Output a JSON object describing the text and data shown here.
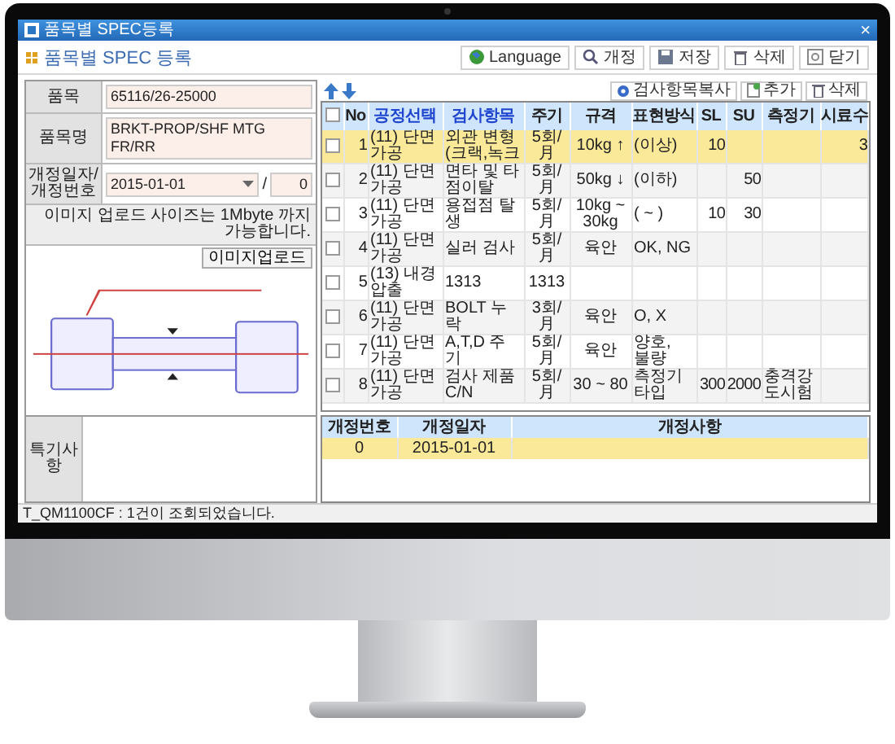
{
  "window": {
    "title": "품목별 SPEC등록",
    "close": "×"
  },
  "header": {
    "title": "품목별 SPEC 등록"
  },
  "toolbar": [
    {
      "label": "Language",
      "kind": "globe"
    },
    {
      "label": "개정",
      "kind": "search"
    },
    {
      "label": "저장",
      "kind": "save"
    },
    {
      "label": "삭제",
      "kind": "trash"
    },
    {
      "label": "닫기",
      "kind": "close"
    }
  ],
  "form": {
    "fields": [
      {
        "label": "품목",
        "value": "65116/26-25000",
        "kind": "text"
      },
      {
        "label": "품목명",
        "value": "BRKT-PROP/SHF MTG FR/RR",
        "kind": "text"
      },
      {
        "label": "개정일자/개정번호",
        "value": "2015-01-01",
        "separator": "/",
        "number": "0",
        "kind": "date"
      }
    ],
    "upload_note": "이미지 업로드 사이즈는 1Mbyte 까지 가능합니다.",
    "upload_button": "이미지업로드",
    "remarks_label": "특기사항"
  },
  "grid": {
    "select_all": {
      "checked": false
    },
    "actions": [
      {
        "label": "검사항목복사",
        "kind": "copy"
      },
      {
        "label": "추가",
        "kind": "add"
      },
      {
        "label": "삭제",
        "kind": "trash"
      }
    ],
    "columns": [
      {
        "label": "No",
        "kind": "plain"
      },
      {
        "label": "공정선택",
        "kind": "link"
      },
      {
        "label": "검사항목",
        "kind": "link"
      },
      {
        "label": "주기",
        "kind": "plain"
      },
      {
        "label": "규격",
        "kind": "plain"
      },
      {
        "label": "표현방식",
        "kind": "plain"
      },
      {
        "label": "SL",
        "kind": "plain"
      },
      {
        "label": "SU",
        "kind": "plain"
      },
      {
        "label": "측정기",
        "kind": "plain"
      },
      {
        "label": "시료수",
        "kind": "plain"
      }
    ],
    "rows": [
      {
        "selected": true,
        "checked": false,
        "cells": [
          "1",
          "(11) 단면가공",
          "외관 변형 (크랙,녹크",
          "5회/月",
          "10kg ↑",
          "(이상)",
          "10",
          null,
          null,
          "3"
        ]
      },
      {
        "selected": false,
        "checked": false,
        "cells": [
          "2",
          "(11) 단면가공",
          "면타 및 타점이탈",
          "5회/月",
          "50kg ↓",
          "(이하)",
          null,
          "50",
          null,
          null
        ]
      },
      {
        "selected": false,
        "checked": false,
        "cells": [
          "3",
          "(11) 단면가공",
          "용접점 탈생",
          "5회/月",
          "10kg ~ 30kg",
          "( ~ )",
          "10",
          "30",
          null,
          null
        ]
      },
      {
        "selected": false,
        "checked": false,
        "cells": [
          "4",
          "(11) 단면가공",
          "실러 검사",
          "5회/月",
          "육안",
          "OK, NG",
          null,
          null,
          null,
          null
        ]
      },
      {
        "selected": false,
        "checked": false,
        "cells": [
          "5",
          "(13) 내경 압출",
          "1313",
          "1313",
          null,
          null,
          null,
          null,
          null,
          null
        ]
      },
      {
        "selected": false,
        "checked": false,
        "cells": [
          "6",
          "(11) 단면가공",
          "BOLT 누락",
          "3회/月",
          "육안",
          "O, X",
          null,
          null,
          null,
          null
        ]
      },
      {
        "selected": false,
        "checked": false,
        "cells": [
          "7",
          "(11) 단면가공",
          "A,T,D 주기",
          "5회/月",
          "육안",
          "양호, 불량",
          null,
          null,
          null,
          null
        ]
      },
      {
        "selected": false,
        "checked": false,
        "cells": [
          "8",
          "(11) 단면가공",
          "검사 제품 C/N",
          "5회/月",
          "30 ~ 80",
          "측정기타입",
          "300",
          "2000",
          "충격강도시험",
          null
        ]
      }
    ]
  },
  "revisions": {
    "columns": [
      "개정번호",
      "개정일자",
      "개정사항"
    ],
    "rows": [
      {
        "selected": true,
        "cells": [
          "0",
          "2015-01-01",
          null
        ]
      }
    ]
  },
  "status_bar": "T_QM1100CF : 1건이 조회되었습니다."
}
